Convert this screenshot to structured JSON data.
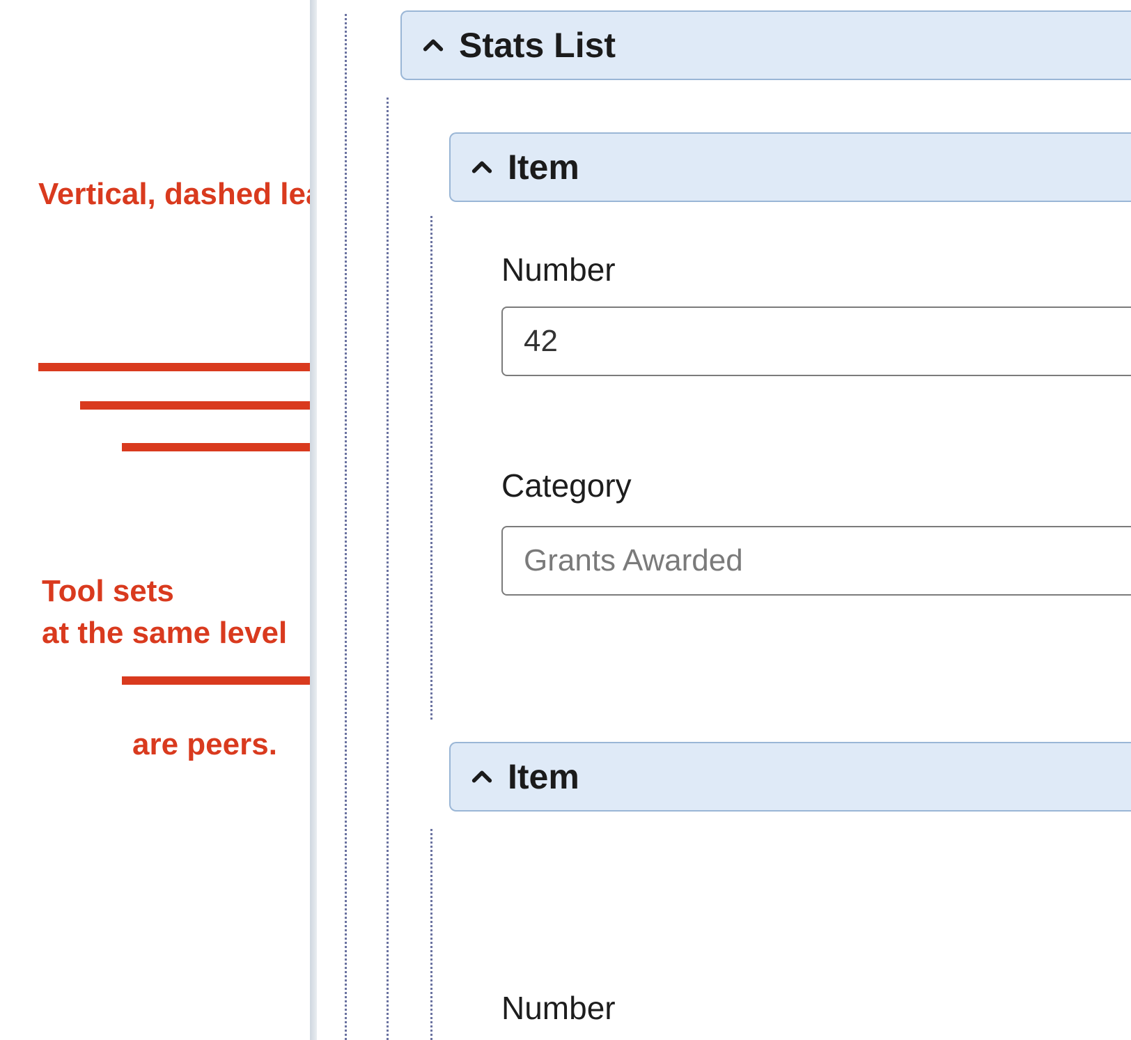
{
  "annotations": {
    "nesting_note": "Vertical, dashed leader-lines indicate nesting.",
    "peers_line1": "Tool sets",
    "peers_line2": "at the same level",
    "peers_line3": "are peers."
  },
  "colors": {
    "annotation": "#d93a1e",
    "panel_header_bg": "#dfeaf7",
    "panel_header_border": "#9ab6d6",
    "leader_line": "#6a72a0"
  },
  "editor": {
    "stats_list": {
      "header_label": "Stats List",
      "items": [
        {
          "header_label": "Item",
          "fields": {
            "number": {
              "label": "Number",
              "value": "42"
            },
            "category": {
              "label": "Category",
              "placeholder": "Grants Awarded"
            }
          }
        },
        {
          "header_label": "Item",
          "fields": {
            "number": {
              "label": "Number"
            }
          }
        }
      ]
    }
  }
}
